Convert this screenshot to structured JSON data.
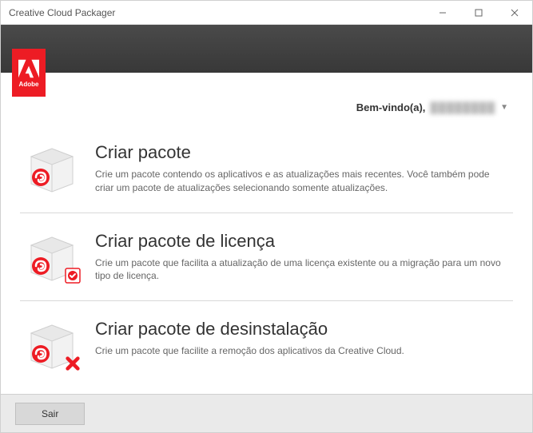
{
  "window": {
    "title": "Creative Cloud Packager"
  },
  "logo": {
    "brand": "Adobe"
  },
  "welcome": {
    "label": "Bem-vindo(a),",
    "username": "████████"
  },
  "options": [
    {
      "title": "Criar pacote",
      "description": "Crie um pacote contendo os aplicativos e as atualizações mais recentes. Você também pode criar um pacote de atualizações selecionando somente atualizações.",
      "icon": "package-create",
      "badge": null
    },
    {
      "title": "Criar pacote de licença",
      "description": "Crie um pacote que facilita a atualização de uma licença existente ou a migração para um novo tipo de licença.",
      "icon": "package-license",
      "badge": "check"
    },
    {
      "title": "Criar pacote de desinstalação",
      "description": "Crie um pacote que facilite a remoção dos aplicativos da Creative Cloud.",
      "icon": "package-uninstall",
      "badge": "remove"
    }
  ],
  "footer": {
    "exit_label": "Sair"
  }
}
